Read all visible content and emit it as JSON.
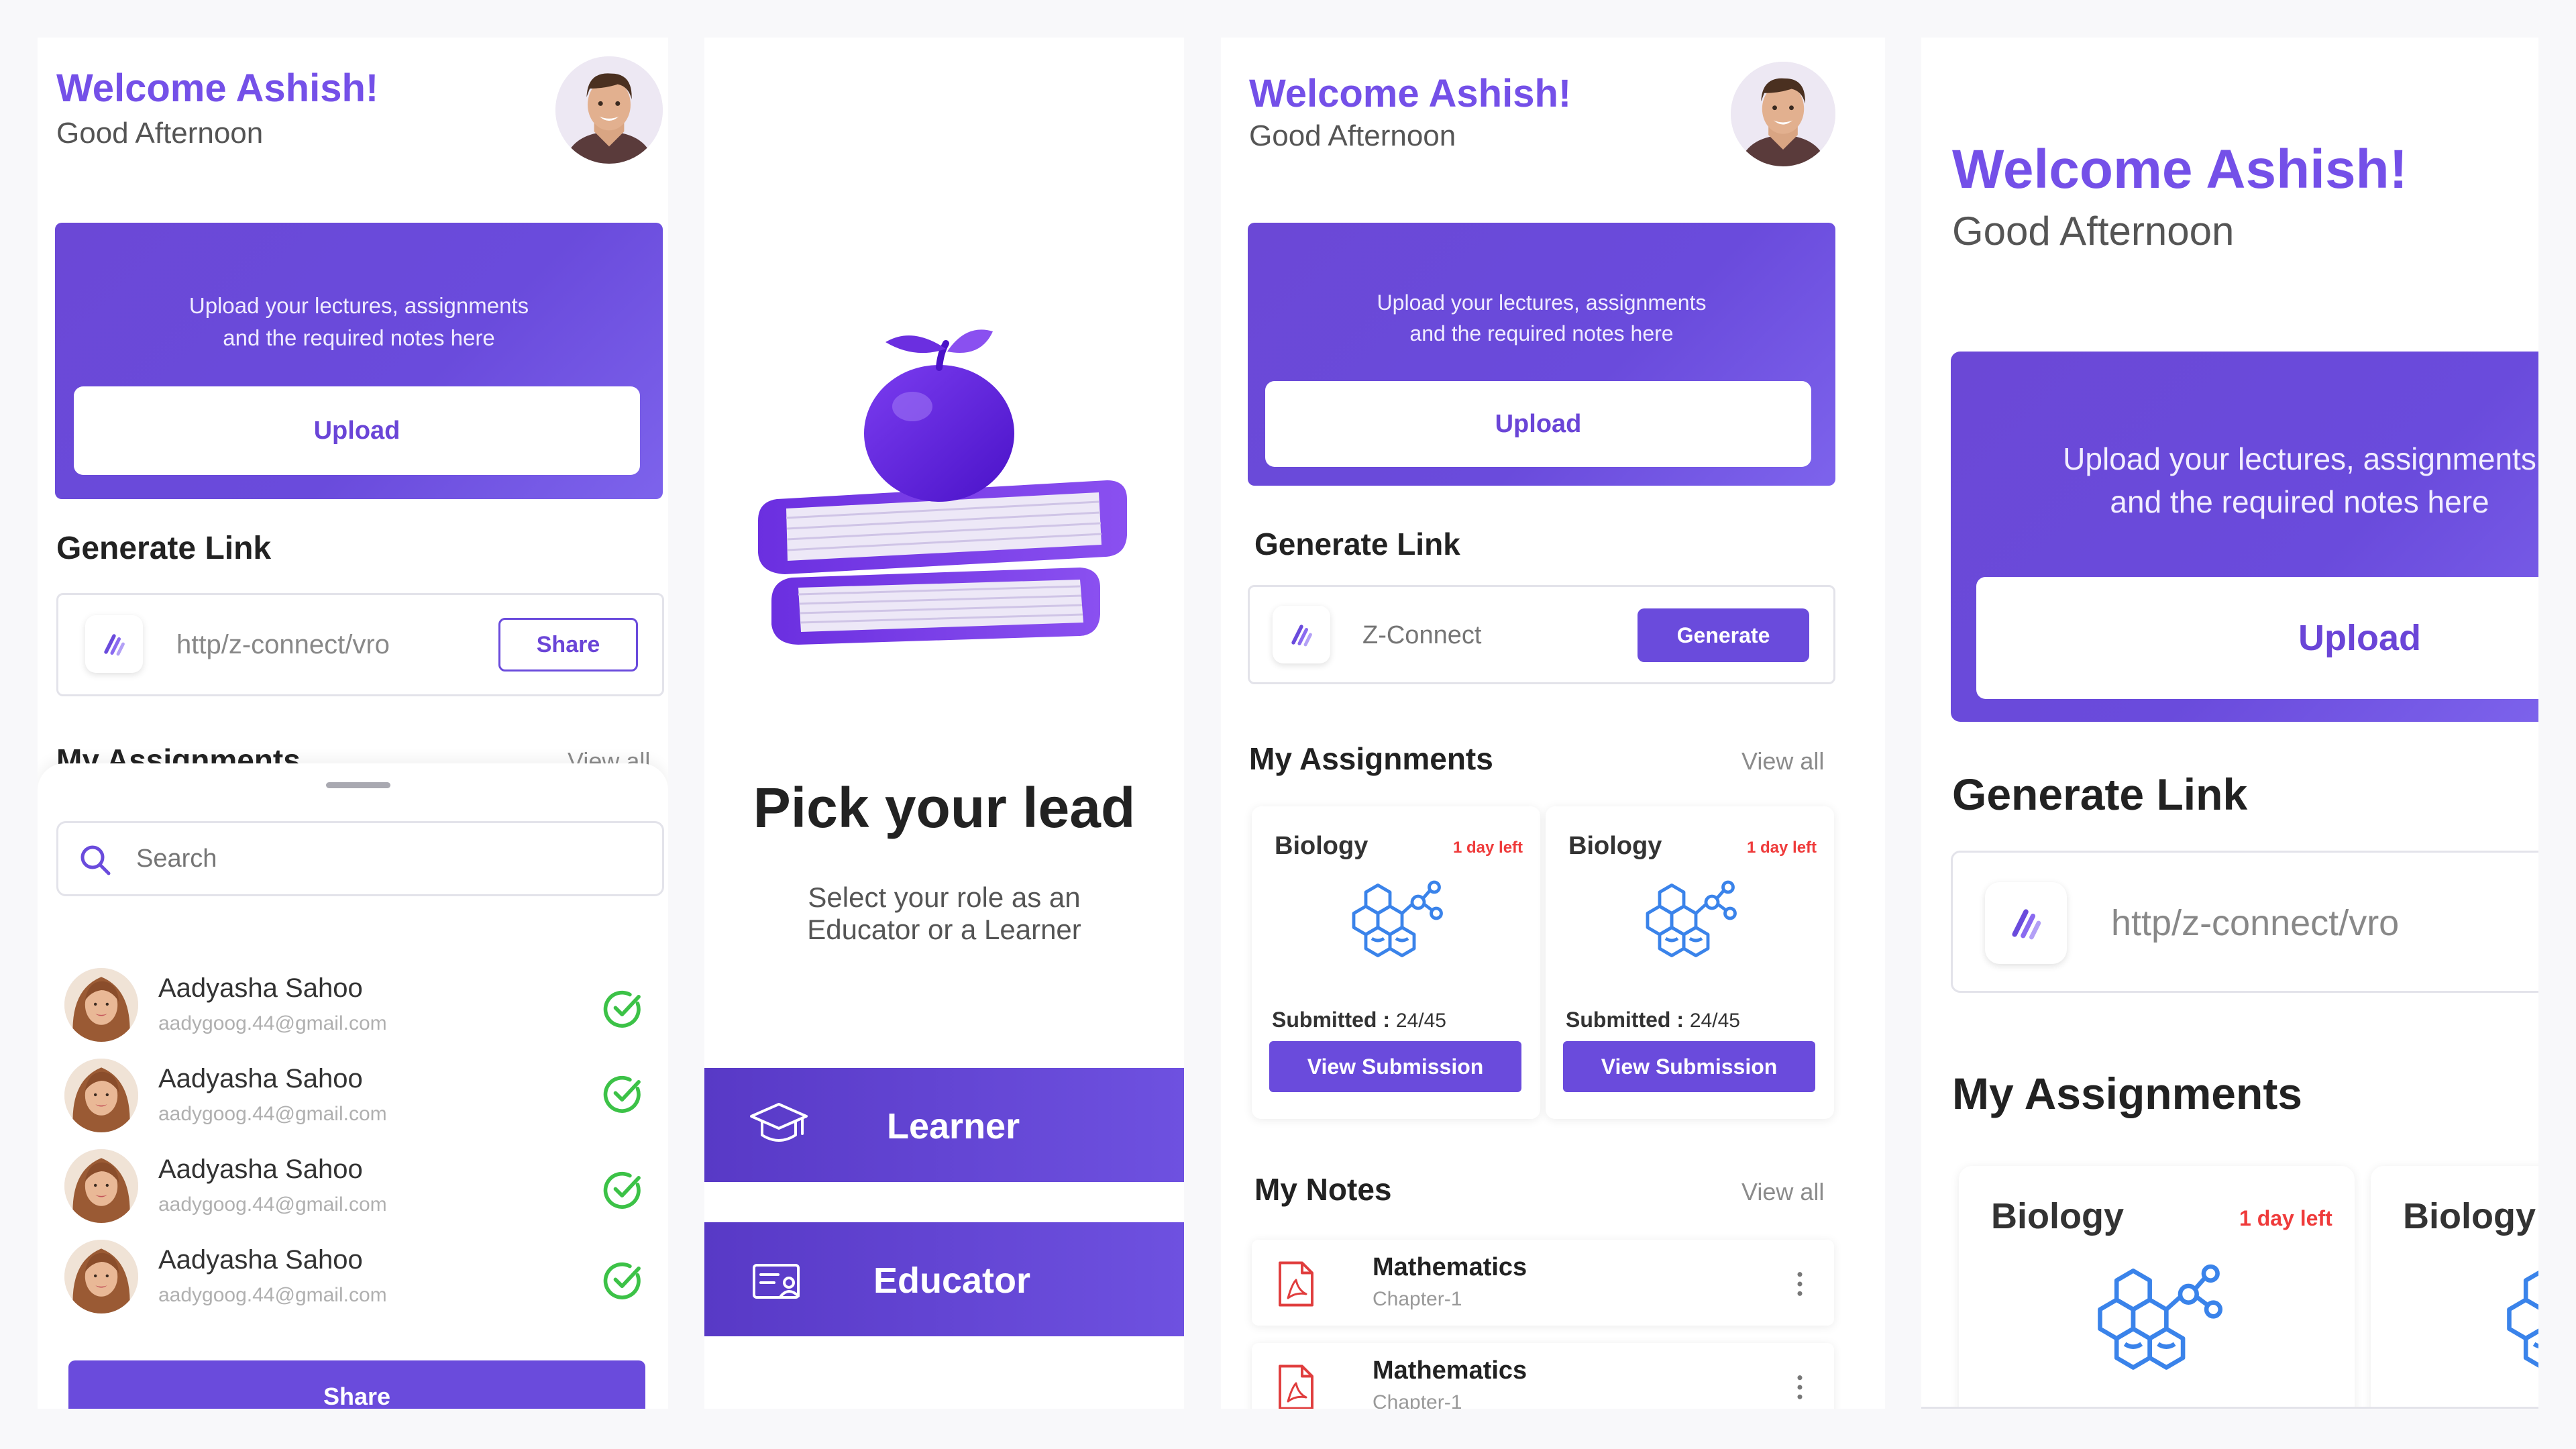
{
  "colors": {
    "accent": "#6a4bdc",
    "welcome": "#7450e8",
    "due": "#ef3b3b",
    "check": "#3cc247",
    "pdf": "#e03d3d",
    "molecule": "#3a83ea"
  },
  "user": {
    "welcome": "Welcome Ashish!",
    "greeting": "Good Afternoon"
  },
  "upload": {
    "text": "Upload your lectures, assignments and the required notes here",
    "button": "Upload"
  },
  "generate_link": {
    "title": "Generate Link",
    "link_value": "http/z-connect/vro",
    "share_button": "Share",
    "placeholder": "Z-Connect",
    "generate_button": "Generate"
  },
  "assignments": {
    "title": "My Assignments",
    "view_all": "View all",
    "items": [
      {
        "subject": "Biology",
        "due": "1 day left",
        "submitted_label": "Submitted :",
        "submitted_value": "24/45",
        "button": "View Submission"
      },
      {
        "subject": "Biology",
        "due": "1 day left",
        "submitted_label": "Submitted :",
        "submitted_value": "24/45",
        "button": "View Submission"
      }
    ]
  },
  "notes": {
    "title": "My Notes",
    "view_all": "View all",
    "items": [
      {
        "title": "Mathematics",
        "subtitle": "Chapter-1"
      },
      {
        "title": "Mathematics",
        "subtitle": "Chapter-1"
      }
    ]
  },
  "share_sheet": {
    "search_placeholder": "Search",
    "people": [
      {
        "name": "Aadyasha Sahoo",
        "email": "aadygoog.44@gmail.com"
      },
      {
        "name": "Aadyasha Sahoo",
        "email": "aadygoog.44@gmail.com"
      },
      {
        "name": "Aadyasha Sahoo",
        "email": "aadygoog.44@gmail.com"
      },
      {
        "name": "Aadyasha Sahoo",
        "email": "aadygoog.44@gmail.com"
      }
    ],
    "share_button": "Share"
  },
  "role": {
    "title": "Pick your lead",
    "subtitle": "Select your role as an Educator or a Learner",
    "learner": "Learner",
    "educator": "Educator"
  },
  "icons": [
    "avatar",
    "z-connect-logo",
    "search-icon",
    "check-circle-icon",
    "molecule-icon",
    "pdf-icon",
    "more-vertical-icon",
    "graduation-cap-icon",
    "id-card-icon",
    "apple-books-illustration"
  ]
}
